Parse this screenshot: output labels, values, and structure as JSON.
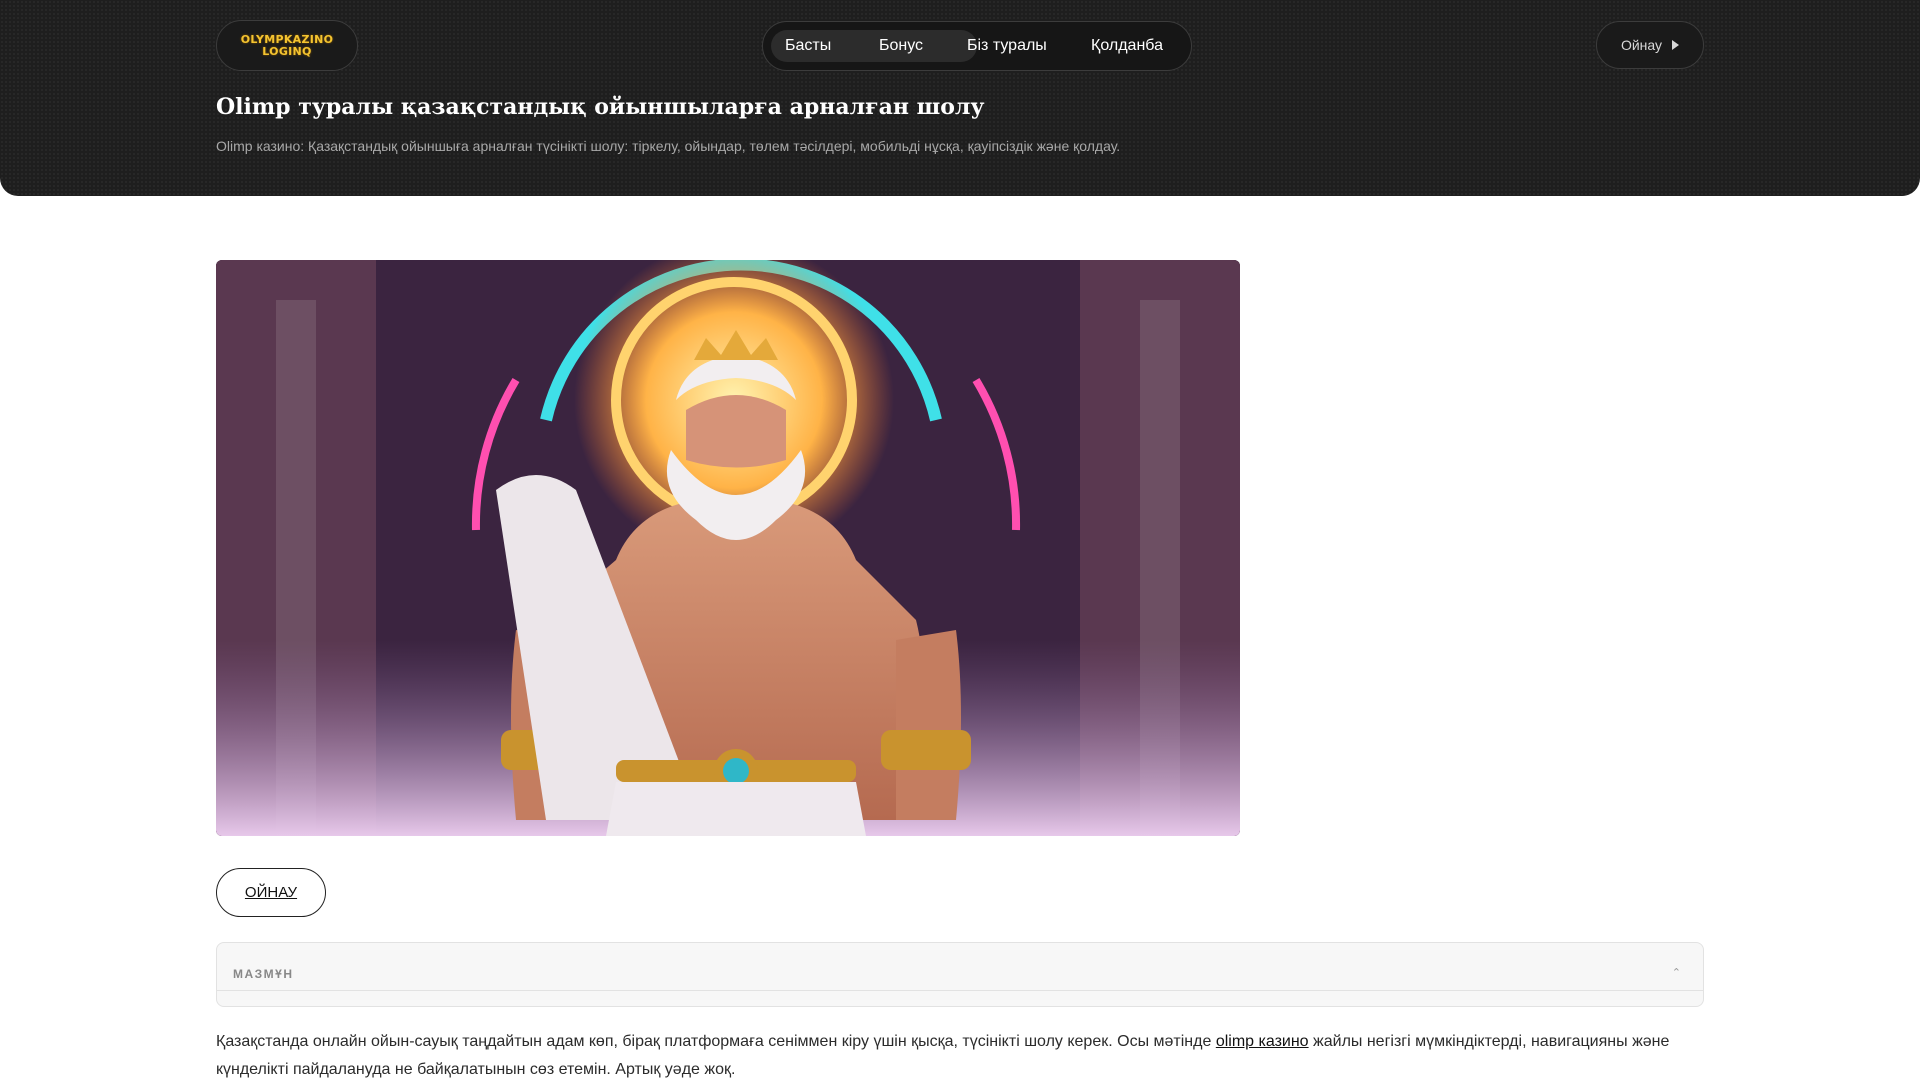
{
  "header": {
    "logo_line1": "OLYMPKAZINO",
    "logo_line2": "LOGINQ",
    "nav": [
      {
        "label": "Басты"
      },
      {
        "label": "Бонус"
      },
      {
        "label": "Біз туралы"
      },
      {
        "label": "Қолданба"
      }
    ],
    "play_label": "Ойнау",
    "title": "Olimp туралы қазақстандық ойыншыларға арналған шолу",
    "subtitle": "Olimp казино: Қазақстандық ойыншыға арналған түсінікті шолу: тіркелу, ойындар, төлем тәсілдері, мобильді нұсқа, қауіпсіздік және қолдау."
  },
  "main": {
    "play_button": "ОЙНАУ",
    "toc_label": "МАЗМҰН",
    "toc_chevron": "⌃",
    "intro_part1": "Қазақстанда онлайн ойын-сауық таңдайтын адам көп, бірақ платформаға сеніммен кіру үшін қысқа, түсінікті шолу керек. Осы мәтінде ",
    "intro_link": "olimp казино",
    "intro_part2": " жайлы негізгі мүмкіндіктерді, навигацияны және күнделікті пайдалануда не байқалатынын сөз етемін. Артық уәде жоқ."
  },
  "colors": {
    "header_bg": "#1e1e1e",
    "logo_gold": "#f4c430",
    "neon_cyan": "#3fe0e8",
    "neon_orange": "#ff9a3c",
    "neon_pink": "#ff4fb0"
  }
}
